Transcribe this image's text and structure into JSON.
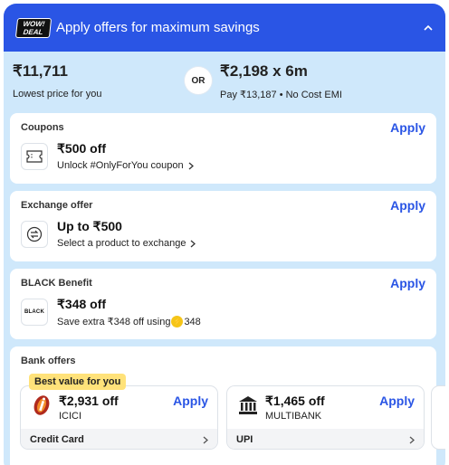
{
  "header": {
    "badge_line1": "WOW!",
    "badge_line2": "DEAL",
    "title": "Apply offers for maximum savings"
  },
  "prices": {
    "lowest_value": "₹11,711",
    "lowest_label": "Lowest price for you",
    "or_label": "OR",
    "emi_value": "₹2,198 x 6m",
    "emi_label": "Pay ₹13,187 • No Cost EMI"
  },
  "coupons": {
    "title": "Coupons",
    "apply_label": "Apply",
    "value": "₹500 off",
    "desc": "Unlock #OnlyForYou coupon"
  },
  "exchange": {
    "title": "Exchange offer",
    "apply_label": "Apply",
    "value": "Up to ₹500",
    "desc": "Select a product to exchange"
  },
  "black": {
    "title": "BLACK Benefit",
    "apply_label": "Apply",
    "icon_text": "BLACK",
    "value": "₹348 off",
    "desc_prefix": "Save extra ₹348 off using",
    "coin_value": "348"
  },
  "bank_offers": {
    "title": "Bank offers",
    "best_tag": "Best value for you",
    "items": [
      {
        "value": "₹2,931 off",
        "name": "ICICI",
        "apply_label": "Apply",
        "footer": "Credit Card"
      },
      {
        "value": "₹1,465 off",
        "name": "MULTIBANK",
        "apply_label": "Apply",
        "footer": "UPI"
      }
    ]
  },
  "colors": {
    "accent": "#2a55e5",
    "panel_bg": "#cfe8fb",
    "tag_bg": "#ffe27a"
  }
}
